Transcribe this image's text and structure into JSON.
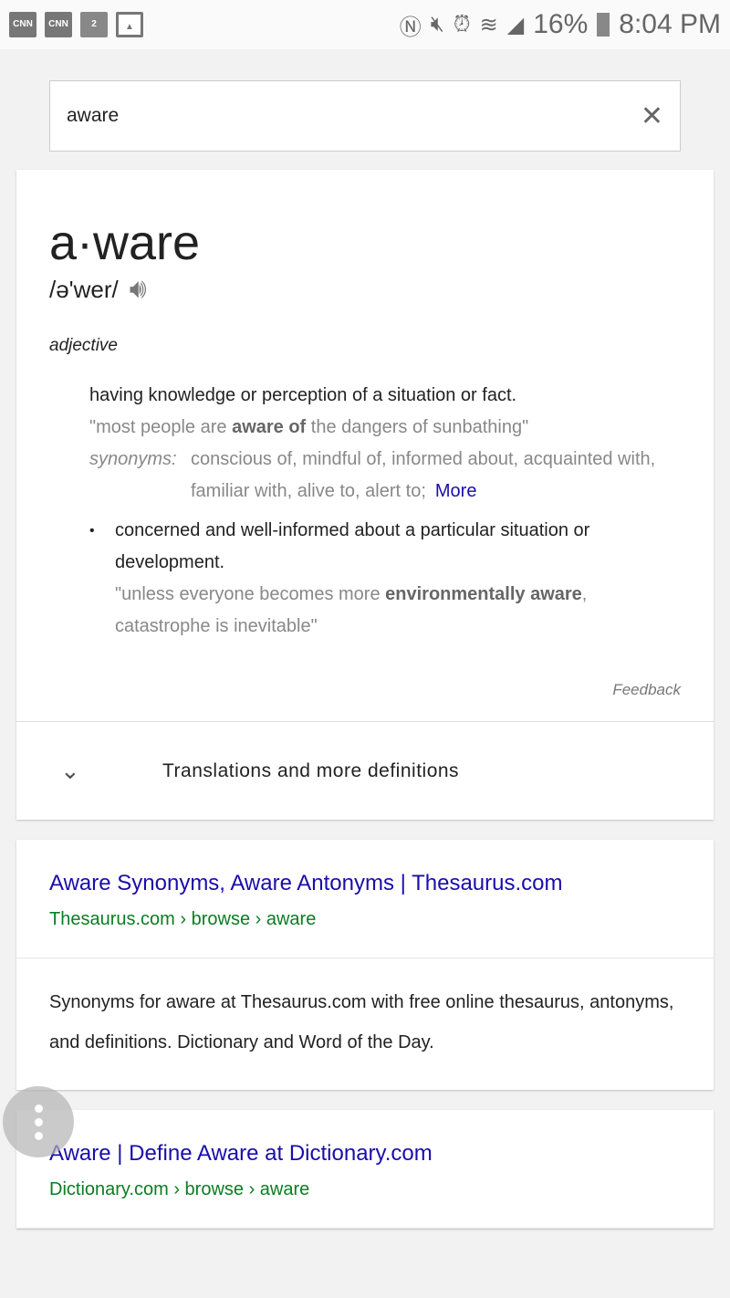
{
  "status_bar": {
    "left_icons": [
      "cnn-icon",
      "cnn-icon",
      "channel-2-icon",
      "image-icon"
    ],
    "cnn": "CNN",
    "battery": "16%",
    "time": "8:04 PM"
  },
  "search": {
    "value": "aware"
  },
  "definition": {
    "word": "a·ware",
    "pronunciation": "/ə'wer/",
    "part_of_speech": "adjective",
    "sense1": {
      "text": "having knowledge or perception of a situation or fact.",
      "example_pre": "\"most people are ",
      "example_bold": "aware of",
      "example_post": " the dangers of sunbathing\"",
      "synonyms_label": "synonyms:",
      "synonyms": "conscious of, mindful of, informed about, acquainted with, familiar with, alive to, alert to;",
      "more": "More"
    },
    "sense2": {
      "text": "concerned and well-informed about a particular situation or development.",
      "example_pre": "\"unless everyone becomes more ",
      "example_bold": "environmentally aware",
      "example_post": ", catastrophe is inevitable\""
    },
    "feedback": "Feedback",
    "translations": "Translations and more definitions"
  },
  "results": [
    {
      "title": "Aware Synonyms, Aware Antonyms | Thesaurus.com",
      "url": "Thesaurus.com › browse › aware",
      "snippet": "Synonyms for aware at Thesaurus.com with free online thesaurus, antonyms, and definitions. Dictionary and Word of the Day."
    },
    {
      "title": "Aware | Define Aware at Dictionary.com",
      "url": "Dictionary.com › browse › aware"
    }
  ],
  "colors": {
    "link": "#1a0dab",
    "url": "#0a7d22"
  }
}
